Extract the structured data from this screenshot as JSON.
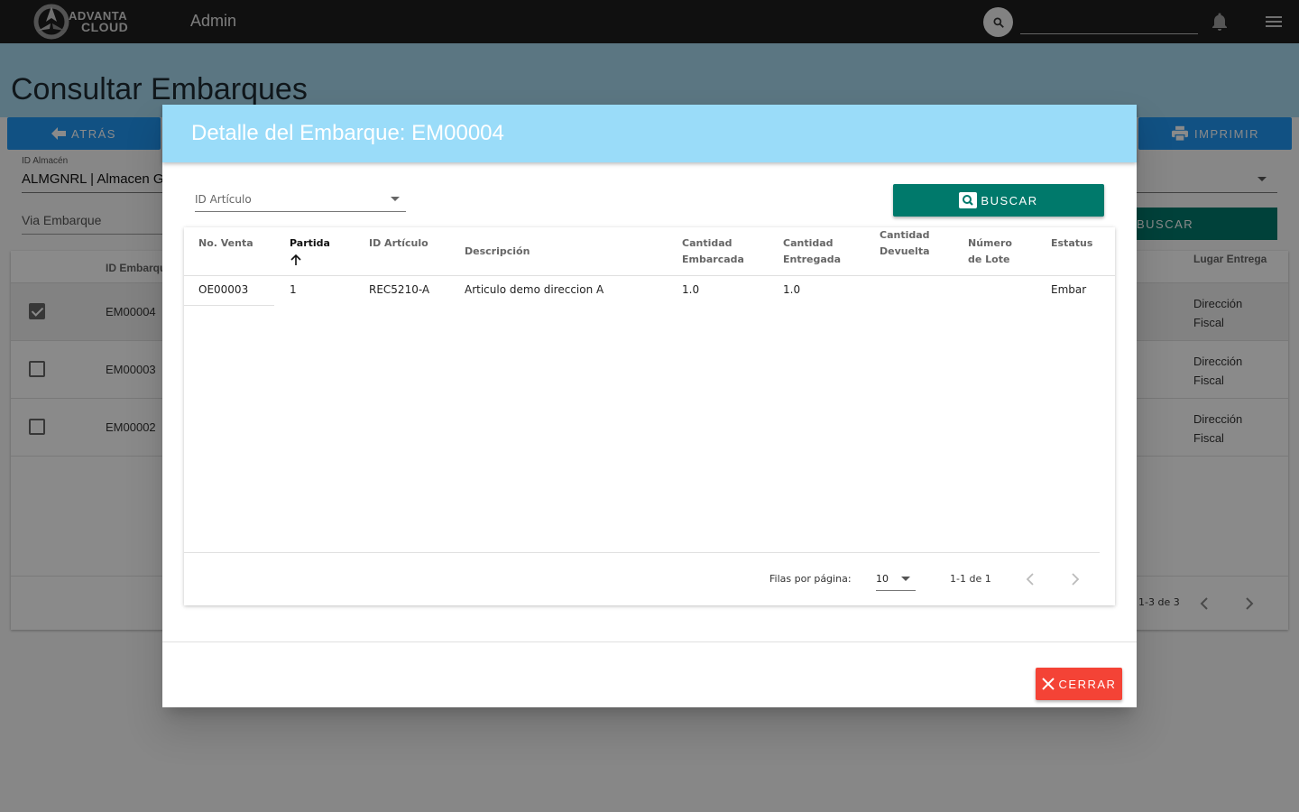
{
  "header": {
    "logo_line1": "ADVANTA",
    "logo_line2": "CLOUD",
    "app_title": "Admin",
    "search_value": ""
  },
  "page": {
    "title": "Consultar Embarques",
    "back_label": "ATRÁS",
    "print_label": "IMPRIMIR",
    "almacen_label": "ID Almacén",
    "almacen_value": "ALMGNRL | Almacen General",
    "via_label": "Via Embarque",
    "buscar_label": "BUSCAR",
    "col_id": "ID Embarque",
    "col_lugar": "Lugar Entrega",
    "rows": [
      {
        "id": "EM00004",
        "lugar": "Dirección Fiscal",
        "checked": true
      },
      {
        "id": "EM00003",
        "lugar": "Dirección Fiscal",
        "checked": false
      },
      {
        "id": "EM00002",
        "lugar": "Dirección Fiscal",
        "checked": false
      }
    ],
    "range": "1-3 de 3"
  },
  "dialog": {
    "title": "Detalle del Embarque: EM00004",
    "filter_label": "ID Artículo",
    "buscar_label": "BUSCAR",
    "columns": {
      "no_venta": "No. Venta",
      "partida": "Partida",
      "id_articulo": "ID Artículo",
      "descripcion": "Descripción",
      "cant_emb_1": "Cantidad",
      "cant_emb_2": "Embarcada",
      "cant_ent_1": "Cantidad",
      "cant_ent_2": "Entregada",
      "cant_dev_1": "Cantidad",
      "cant_dev_2": "Devuelta",
      "lote_1": "Número",
      "lote_2": "de Lote",
      "estatus": "Estatus"
    },
    "row": {
      "no_venta": "OE00003",
      "partida": "1",
      "id_articulo": "REC5210-A",
      "descripcion": "Articulo demo direccion A",
      "cant_emb": "1.0",
      "cant_ent": "1.0",
      "cant_dev": "",
      "lote": "",
      "estatus": "Embar"
    },
    "rows_per_page_label": "Filas por página:",
    "rows_per_page": "10",
    "range": "1-1 de 1",
    "close_label": "CERRAR"
  }
}
